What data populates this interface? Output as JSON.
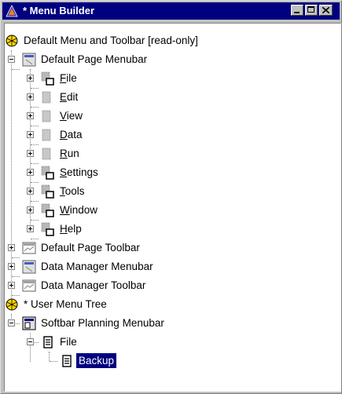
{
  "window": {
    "title": "* Menu Builder",
    "colors": {
      "titlebar": "#000080",
      "selection": "#000080"
    }
  },
  "tree": {
    "default_root": "Default Menu and Toolbar [read-only]",
    "default_page_menubar": "Default Page Menubar",
    "menus": [
      {
        "mnemonic": "F",
        "rest": "ile"
      },
      {
        "mnemonic": "E",
        "rest": "dit"
      },
      {
        "mnemonic": "V",
        "rest": "iew"
      },
      {
        "mnemonic": "D",
        "rest": "ata"
      },
      {
        "mnemonic": "R",
        "rest": "un"
      },
      {
        "mnemonic": "S",
        "rest": "ettings"
      },
      {
        "mnemonic": "T",
        "rest": "ools"
      },
      {
        "mnemonic": "W",
        "rest": "indow"
      },
      {
        "mnemonic": "H",
        "rest": "elp"
      }
    ],
    "default_page_toolbar": "Default Page Toolbar",
    "data_manager_menubar": "Data Manager Menubar",
    "data_manager_toolbar": "Data Manager Toolbar",
    "user_root": "* User Menu Tree",
    "softbar_menubar": "Softbar Planning Menubar",
    "file_item": "File",
    "backup_item": "Backup"
  }
}
